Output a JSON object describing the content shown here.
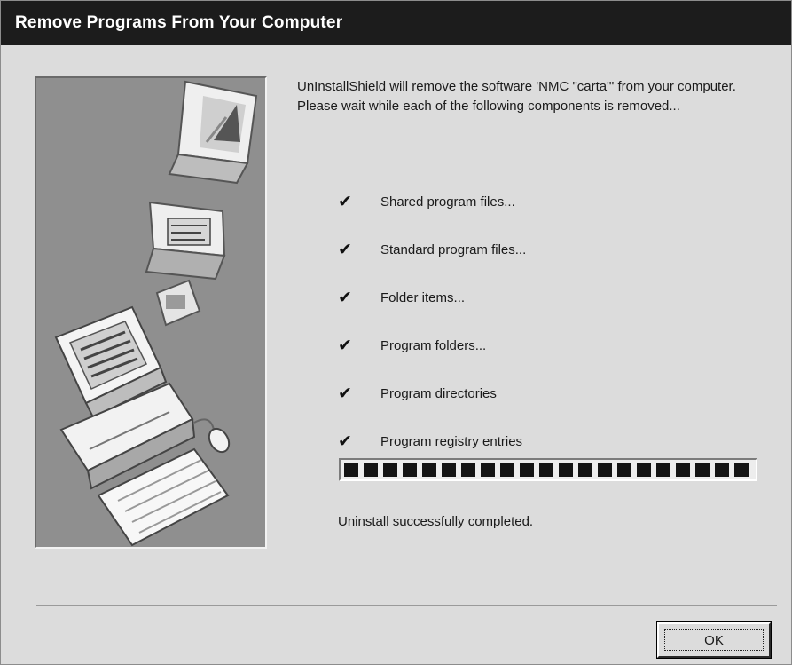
{
  "window": {
    "title": "Remove Programs From Your Computer"
  },
  "illustration": {
    "icon": "computer-install-illustration-icon"
  },
  "message": "UnInstallShield will remove the software 'NMC \"carta\"' from your computer. Please wait while each of the following components is removed...",
  "steps": [
    {
      "label": "Shared program files...",
      "done": true,
      "icon": "checkmark-icon"
    },
    {
      "label": "Standard program files...",
      "done": true,
      "icon": "checkmark-icon"
    },
    {
      "label": "Folder items...",
      "done": true,
      "icon": "checkmark-icon"
    },
    {
      "label": "Program folders...",
      "done": true,
      "icon": "checkmark-icon"
    },
    {
      "label": "Program directories",
      "done": true,
      "icon": "checkmark-icon"
    },
    {
      "label": "Program registry entries",
      "done": true,
      "icon": "checkmark-icon"
    }
  ],
  "check_glyph": "✔",
  "progress": {
    "percent": 100
  },
  "status": "Uninstall successfully completed.",
  "buttons": {
    "ok_label": "OK"
  },
  "colors": {
    "titlebar": "#1c1c1c",
    "window_face": "#dcdcdc",
    "progress_fill": "#141414"
  }
}
